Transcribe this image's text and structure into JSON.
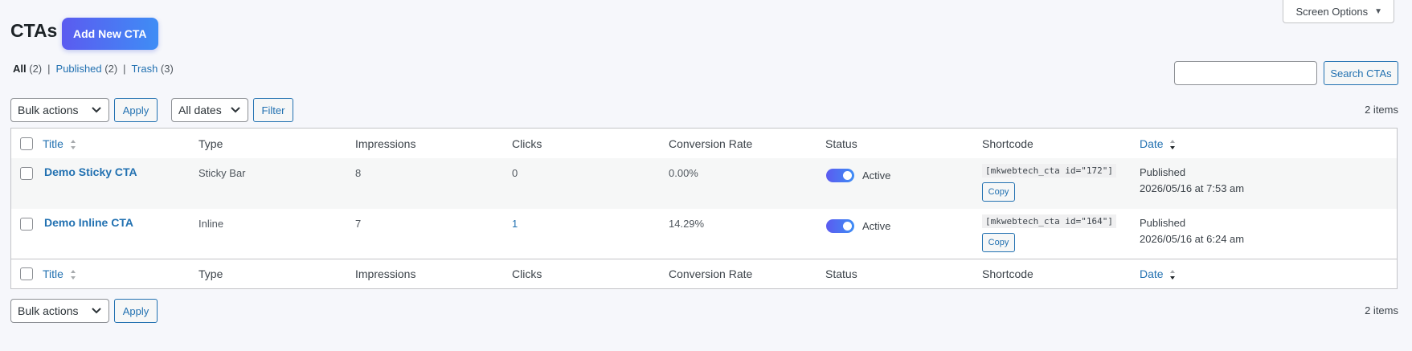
{
  "header": {
    "screen_options": "Screen Options",
    "page_title": "CTAs",
    "add_new": "Add New CTA"
  },
  "views": {
    "all_label": "All",
    "all_count": "(2)",
    "published_label": "Published",
    "published_count": "(2)",
    "trash_label": "Trash",
    "trash_count": "(3)",
    "separator": "|"
  },
  "search": {
    "value": "",
    "button": "Search CTAs"
  },
  "tablenav": {
    "bulk_actions": "Bulk actions",
    "apply": "Apply",
    "dates": "All dates",
    "filter": "Filter",
    "items_count": "2 items"
  },
  "columns": {
    "title": "Title",
    "type": "Type",
    "impressions": "Impressions",
    "clicks": "Clicks",
    "conversion_rate": "Conversion Rate",
    "status": "Status",
    "shortcode": "Shortcode",
    "date": "Date"
  },
  "rows": [
    {
      "title": "Demo Sticky CTA",
      "type": "Sticky Bar",
      "impressions": "8",
      "clicks": "0",
      "conversion_rate": "0.00%",
      "status": "Active",
      "active": true,
      "shortcode": "[mkwebtech_cta id=\"172\"]",
      "copy": "Copy",
      "date_status": "Published",
      "date": "2026/05/16 at 7:53 am"
    },
    {
      "title": "Demo Inline CTA",
      "type": "Inline",
      "impressions": "7",
      "clicks": "1",
      "conversion_rate": "14.29%",
      "status": "Active",
      "active": true,
      "shortcode": "[mkwebtech_cta id=\"164\"]",
      "copy": "Copy",
      "date_status": "Published",
      "date": "2026/05/16 at 6:24 am"
    }
  ],
  "colors": {
    "accent": "#2271b1",
    "toggle_start": "#5b5bf0",
    "toggle_end": "#3f8df5"
  }
}
